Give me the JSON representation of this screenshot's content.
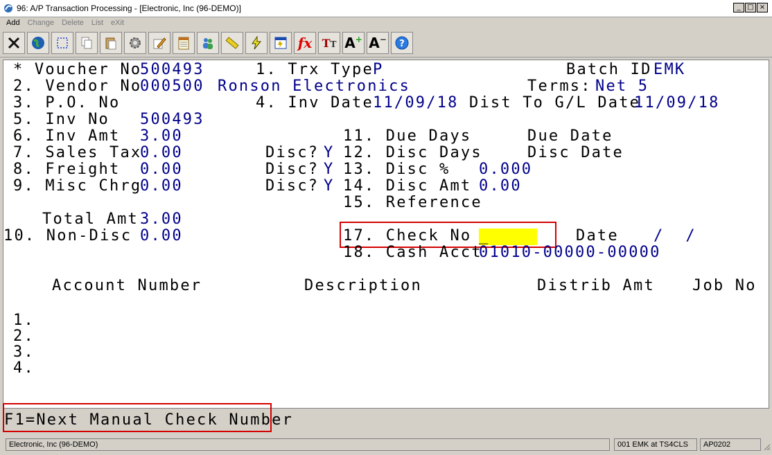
{
  "window": {
    "title": "96: A/P Transaction Processing - [Electronic, Inc (96-DEMO)]",
    "buttons": [
      "_",
      "□",
      "×"
    ]
  },
  "menu": [
    {
      "label": "Add",
      "enabled": true
    },
    {
      "label": "Change",
      "enabled": false
    },
    {
      "label": "Delete",
      "enabled": false
    },
    {
      "label": "List",
      "enabled": false
    },
    {
      "label": "eXit",
      "enabled": false
    }
  ],
  "toolbar": {
    "icons": [
      "close-x-icon",
      "globe-icon",
      "select-box-icon",
      "copy-icon",
      "paste-icon",
      "settings-gear-icon",
      "edit-pencil-icon",
      "notepad-icon",
      "users-icon",
      "ruler-icon",
      "lightning-icon",
      "calculator-icon",
      "function-fx-icon",
      "font-tt-icon",
      "font-increase-icon",
      "font-decrease-icon",
      "help-icon"
    ]
  },
  "form": {
    "voucher_label": "* Voucher No",
    "voucher_no": "500493",
    "trx_type_label": "1. Trx Type",
    "trx_type": "P",
    "batch_label": "Batch ID",
    "batch_id": "EMK",
    "vendor_label": "2. Vendor No",
    "vendor_no": "000500",
    "vendor_name": "Ronson Electronics",
    "terms_label": "Terms:",
    "terms": "Net 5",
    "po_label": "3. P.O. No",
    "inv_date_label": "4. Inv Date",
    "inv_date": "11/09/18",
    "dist_label": "Dist To G/L Date",
    "dist_date": "11/09/18",
    "inv_no_label": "5. Inv No",
    "inv_no": "500493",
    "inv_amt_label": "6. Inv Amt",
    "inv_amt": "3.00",
    "due_days_label": "11. Due Days",
    "due_date_label": "Due Date",
    "sales_tax_label": "7. Sales Tax",
    "sales_tax": "0.00",
    "disc_q_label": "Disc?",
    "sales_tax_disc": "Y",
    "disc_days_label": "12. Disc Days",
    "disc_date_label": "Disc Date",
    "freight_label": "8. Freight",
    "freight": "0.00",
    "freight_disc": "Y",
    "disc_pct_label": "13. Disc %",
    "disc_pct": "0.000",
    "misc_label": "9. Misc Chrg",
    "misc": "0.00",
    "misc_disc": "Y",
    "disc_amt_label": "14. Disc Amt",
    "disc_amt": "0.00",
    "reference_label": "15. Reference",
    "total_label": "Total Amt",
    "total": "3.00",
    "nondisc_label": "10. Non-Disc",
    "nondisc": "0.00",
    "check_label": "17. Check No",
    "check_no": "_",
    "date_label": "Date",
    "date_value": "/  /",
    "cash_label": "18. Cash Acct",
    "cash_acct": "01010-00000-00000"
  },
  "dist_table": {
    "headers": [
      "Account Number",
      "Description",
      "Distrib Amt",
      "Job No"
    ],
    "rows": [
      "1.",
      "2.",
      "3.",
      "4."
    ]
  },
  "fkey_hint": "F1=Next Manual Check Number",
  "status": {
    "company": "Electronic, Inc (96-DEMO)",
    "user": "001 EMK at TS4CLS",
    "program": "AP0202"
  }
}
